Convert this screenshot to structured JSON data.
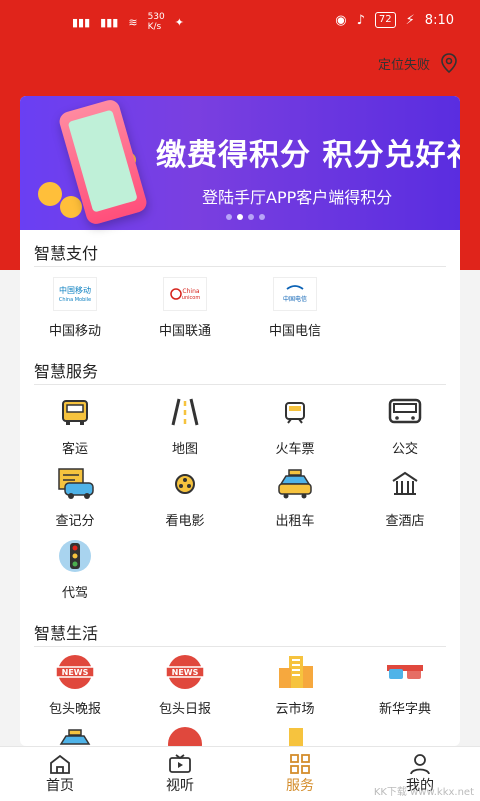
{
  "status": {
    "network_speed": "530\nK/s",
    "battery": "72",
    "time": "8:10"
  },
  "header": {
    "location_text": "定位失败",
    "location_icon": "location-pin-icon"
  },
  "banner": {
    "title": "缴费得积分 积分兑好礼",
    "subtitle": "登陆手厅APP客户端得积分",
    "page_count": 4,
    "active_page": 2
  },
  "sections": [
    {
      "title": "智慧支付",
      "items": [
        {
          "label": "中国移动",
          "icon": "china-mobile-logo"
        },
        {
          "label": "中国联通",
          "icon": "china-unicom-logo"
        },
        {
          "label": "中国电信",
          "icon": "china-telecom-logo"
        }
      ]
    },
    {
      "title": "智慧服务",
      "items": [
        {
          "label": "客运",
          "icon": "coach-bus-icon"
        },
        {
          "label": "地图",
          "icon": "road-map-icon"
        },
        {
          "label": "火车票",
          "icon": "train-icon"
        },
        {
          "label": "公交",
          "icon": "city-bus-icon"
        },
        {
          "label": "查记分",
          "icon": "car-record-icon"
        },
        {
          "label": "看电影",
          "icon": "film-reel-icon"
        },
        {
          "label": "出租车",
          "icon": "taxi-icon"
        },
        {
          "label": "查酒店",
          "icon": "hotel-icon"
        },
        {
          "label": "代驾",
          "icon": "traffic-light-icon"
        }
      ]
    },
    {
      "title": "智慧生活",
      "items": [
        {
          "label": "包头晚报",
          "icon": "news-badge-icon"
        },
        {
          "label": "包头日报",
          "icon": "news-badge-icon"
        },
        {
          "label": "云市场",
          "icon": "market-building-icon"
        },
        {
          "label": "新华字典",
          "icon": "3d-glasses-icon"
        }
      ]
    }
  ],
  "tabs": [
    {
      "label": "首页",
      "icon": "home-icon"
    },
    {
      "label": "视听",
      "icon": "tv-icon"
    },
    {
      "label": "服务",
      "icon": "grid-icon",
      "active": true
    },
    {
      "label": "我的",
      "icon": "user-icon"
    }
  ],
  "watermark": "KK下载 www.kkx.net",
  "colors": {
    "brand_red": "#e0241b",
    "active_tab": "#d48d2c",
    "banner_purple": "#6a3ff3"
  }
}
